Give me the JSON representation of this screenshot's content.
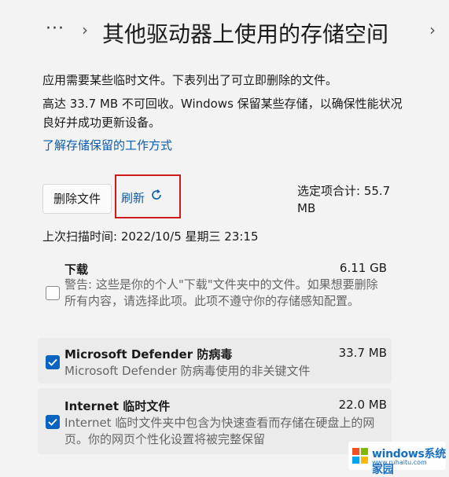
{
  "breadcrumb": {
    "more": "···",
    "sep": "›",
    "title": "其他驱动器上使用的存储空间",
    "trail_sep": "›"
  },
  "description": {
    "line1": "应用需要某些临时文件。下表列出了可立即删除的文件。",
    "line2": "高达 33.7 MB 不可回收。Windows 保留某些存储，以确保性能状况良好并成功更新设备。"
  },
  "learn_link": "了解存储保留的工作方式",
  "actions": {
    "delete_label": "删除文件",
    "refresh_label": "刷新"
  },
  "selected_total": "选定项合计: 55.7 MB",
  "last_scan": "上次扫描时间: 2022/10/5 星期三 23:15",
  "items": [
    {
      "title": "下载",
      "size": "6.11 GB",
      "desc": "警告: 这些是你的个人\"下载\"文件夹中的文件。如果想要删除所有内容，请选择此项。此项不遵守你的存储感知配置。",
      "checked": false
    },
    {
      "title": "Microsoft Defender 防病毒",
      "size": "33.7 MB",
      "desc": "Microsoft Defender 防病毒使用的非关键文件",
      "checked": true
    },
    {
      "title": "Internet 临时文件",
      "size": "22.0 MB",
      "desc": "Internet 临时文件夹中包含为快速查看而存储在硬盘上的网页。你的网页个性化设置将被完整保留",
      "checked": true
    }
  ],
  "watermark": {
    "name": "windows系统家园",
    "url": "www.ruhaitu.com"
  },
  "colors": {
    "accent": "#0a63c0",
    "link": "#0b5cad",
    "highlight": "#d11a1a"
  }
}
